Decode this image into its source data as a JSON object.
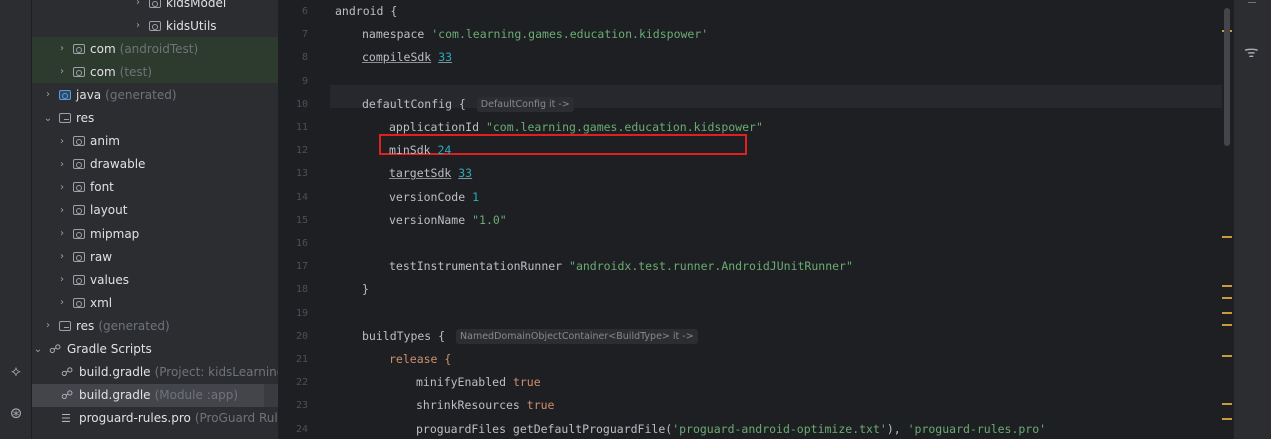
{
  "project_tree": {
    "rows": [
      {
        "indent": 126,
        "chevron": "›",
        "icon": "folder-icon",
        "name": "kidsModel",
        "suffix": "",
        "style": "normal"
      },
      {
        "indent": 126,
        "chevron": "›",
        "icon": "folder-icon",
        "name": "kidsUtils",
        "suffix": "",
        "style": "normal"
      },
      {
        "indent": 50,
        "chevron": "›",
        "icon": "folder-icon",
        "name": "com",
        "suffix": "(androidTest)",
        "style": "green"
      },
      {
        "indent": 50,
        "chevron": "›",
        "icon": "folder-icon",
        "name": "com",
        "suffix": "(test)",
        "style": "green"
      },
      {
        "indent": 36,
        "chevron": "›",
        "icon": "source-folder-icon",
        "name": "java",
        "suffix": "(generated)",
        "style": "normal"
      },
      {
        "indent": 36,
        "chevron": "⌄",
        "icon": "resources-folder-icon",
        "name": "res",
        "suffix": "",
        "style": "normal"
      },
      {
        "indent": 50,
        "chevron": "›",
        "icon": "folder-icon",
        "name": "anim",
        "suffix": "",
        "style": "normal"
      },
      {
        "indent": 50,
        "chevron": "›",
        "icon": "folder-icon",
        "name": "drawable",
        "suffix": "",
        "style": "normal"
      },
      {
        "indent": 50,
        "chevron": "›",
        "icon": "folder-icon",
        "name": "font",
        "suffix": "",
        "style": "normal"
      },
      {
        "indent": 50,
        "chevron": "›",
        "icon": "folder-icon",
        "name": "layout",
        "suffix": "",
        "style": "normal"
      },
      {
        "indent": 50,
        "chevron": "›",
        "icon": "folder-icon",
        "name": "mipmap",
        "suffix": "",
        "style": "normal"
      },
      {
        "indent": 50,
        "chevron": "›",
        "icon": "folder-icon",
        "name": "raw",
        "suffix": "",
        "style": "normal"
      },
      {
        "indent": 50,
        "chevron": "›",
        "icon": "folder-icon",
        "name": "values",
        "suffix": "",
        "style": "normal"
      },
      {
        "indent": 50,
        "chevron": "›",
        "icon": "folder-icon",
        "name": "xml",
        "suffix": "",
        "style": "normal"
      },
      {
        "indent": 36,
        "chevron": "›",
        "icon": "resources-folder-icon",
        "name": "res",
        "suffix": "(generated)",
        "style": "normal"
      },
      {
        "indent": 22,
        "chevron": "⌄",
        "icon": "gradle-icon",
        "name": "Gradle Scripts",
        "suffix": "",
        "style": "normal"
      },
      {
        "indent": 38,
        "chevron": "",
        "icon": "gradle-icon",
        "name": "build.gradle",
        "suffix": "(Project: kidsLearning)",
        "style": "normal"
      },
      {
        "indent": 38,
        "chevron": "",
        "icon": "gradle-icon",
        "name": "build.gradle",
        "suffix": "(Module :app)",
        "style": "selected"
      },
      {
        "indent": 38,
        "chevron": "",
        "icon": "proguard-file-icon",
        "name": "proguard-rules.pro",
        "suffix": "(ProGuard Rules",
        "style": "normal"
      }
    ]
  },
  "editor": {
    "first_line_number": 6,
    "line_numbers": [
      "6",
      "7",
      "8",
      "9",
      "10",
      "11",
      "12",
      "13",
      "14",
      "15",
      "16",
      "17",
      "18",
      "19",
      "20",
      "21",
      "22",
      "23",
      "24"
    ],
    "lines": [
      {
        "indent": 0,
        "tokens": [
          {
            "t": "android {",
            "c": "fn"
          }
        ]
      },
      {
        "indent": 1,
        "tokens": [
          {
            "t": "namespace ",
            "c": "fn"
          },
          {
            "t": "'com.learning.games.education.kidspower'",
            "c": "str"
          }
        ]
      },
      {
        "indent": 1,
        "tokens": [
          {
            "t": "compileSdk",
            "c": "fn ul"
          },
          {
            "t": " ",
            "c": "fn"
          },
          {
            "t": "33",
            "c": "num ul"
          }
        ]
      },
      {
        "indent": 0,
        "tokens": []
      },
      {
        "indent": 1,
        "tokens": [
          {
            "t": "defaultConfig { ",
            "c": "fn"
          }
        ],
        "hint": "DefaultConfig it ->"
      },
      {
        "indent": 2,
        "tokens": [
          {
            "t": "applicationId ",
            "c": "fn"
          },
          {
            "t": "\"com.learning.games.education.kidspower\"",
            "c": "str"
          }
        ]
      },
      {
        "indent": 2,
        "tokens": [
          {
            "t": "minSdk ",
            "c": "fn"
          },
          {
            "t": "24",
            "c": "num"
          }
        ]
      },
      {
        "indent": 2,
        "tokens": [
          {
            "t": "targetSdk",
            "c": "fn ul"
          },
          {
            "t": " ",
            "c": "fn"
          },
          {
            "t": "33",
            "c": "num ul"
          }
        ]
      },
      {
        "indent": 2,
        "tokens": [
          {
            "t": "versionCode ",
            "c": "fn"
          },
          {
            "t": "1",
            "c": "num"
          }
        ]
      },
      {
        "indent": 2,
        "tokens": [
          {
            "t": "versionName ",
            "c": "fn"
          },
          {
            "t": "\"1.0\"",
            "c": "str"
          }
        ]
      },
      {
        "indent": 0,
        "tokens": []
      },
      {
        "indent": 2,
        "tokens": [
          {
            "t": "testInstrumentationRunner ",
            "c": "fn"
          },
          {
            "t": "\"androidx.test.runner.AndroidJUnitRunner\"",
            "c": "str"
          }
        ]
      },
      {
        "indent": 1,
        "tokens": [
          {
            "t": "}",
            "c": "fn"
          }
        ]
      },
      {
        "indent": 0,
        "tokens": []
      },
      {
        "indent": 1,
        "tokens": [
          {
            "t": "buildTypes { ",
            "c": "fn"
          }
        ],
        "hint": "NamedDomainObjectContainer<BuildType> it ->"
      },
      {
        "indent": 2,
        "tokens": [
          {
            "t": "release {",
            "c": "kw"
          }
        ]
      },
      {
        "indent": 3,
        "tokens": [
          {
            "t": "minifyEnabled ",
            "c": "fn"
          },
          {
            "t": "true",
            "c": "kw"
          }
        ]
      },
      {
        "indent": 3,
        "tokens": [
          {
            "t": "shrinkResources ",
            "c": "fn"
          },
          {
            "t": "true",
            "c": "kw"
          }
        ]
      },
      {
        "indent": 3,
        "tokens": [
          {
            "t": "proguardFiles getDefaultProguardFile(",
            "c": "fn"
          },
          {
            "t": "'proguard-android-optimize.txt'",
            "c": "str"
          },
          {
            "t": "), ",
            "c": "fn"
          },
          {
            "t": "'proguard-rules.pro'",
            "c": "str"
          }
        ]
      }
    ],
    "highlighted_line_number": "11",
    "current_line_number": "9"
  },
  "left_toolbar": {
    "icons": [
      "build-variants-icon",
      "gradle-tool-icon"
    ]
  },
  "right_toolbar": {
    "icons": [
      "device-manager-icon"
    ]
  },
  "colors": {
    "keyword": "#cf8e6d",
    "string": "#6aab73",
    "number": "#2aacb8",
    "highlight_box": "#e0201f",
    "bulb": "#f2c55c"
  }
}
